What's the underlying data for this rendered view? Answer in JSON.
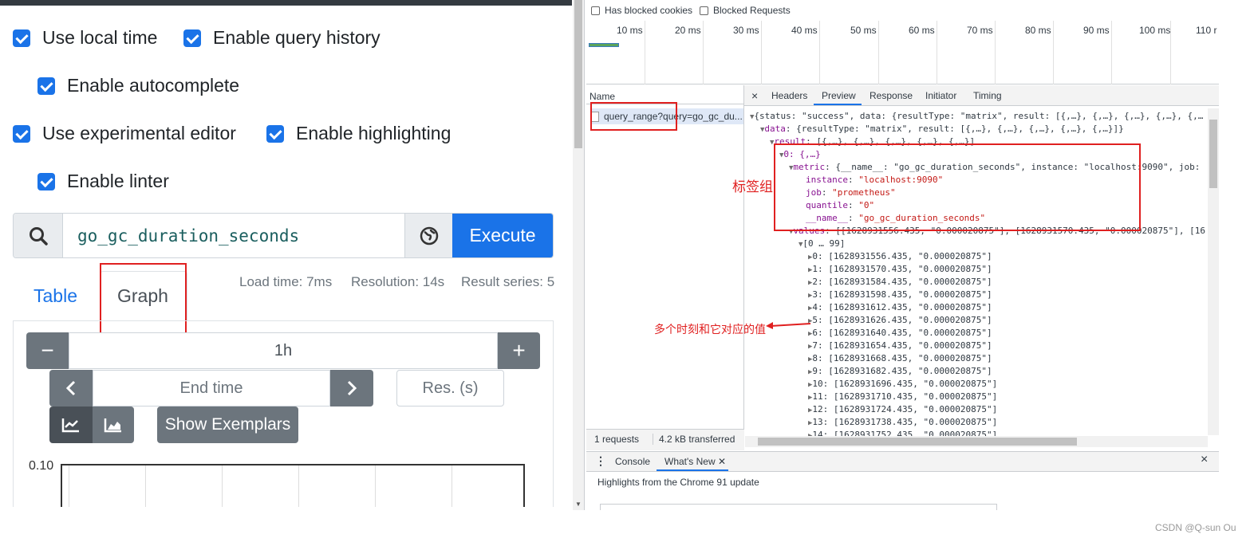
{
  "settings": {
    "use_local_time": "Use local time",
    "enable_query_history": "Enable query history",
    "enable_autocomplete": "Enable autocomplete",
    "use_experimental_editor": "Use experimental editor",
    "enable_highlighting": "Enable highlighting",
    "enable_linter": "Enable linter"
  },
  "query": {
    "value": "go_gc_duration_seconds",
    "execute_label": "Execute"
  },
  "tabs": {
    "table": "Table",
    "graph": "Graph"
  },
  "stats": {
    "load_time": "Load time: 7ms",
    "resolution": "Resolution: 14s",
    "result_series": "Result series: 5"
  },
  "graph_controls": {
    "minus": "−",
    "range": "1h",
    "plus": "+",
    "end_time_placeholder": "End time",
    "res_placeholder": "Res. (s)",
    "show_exemplars": "Show Exemplars",
    "y_tick_top": "0.10"
  },
  "devtools": {
    "has_blocked_cookies": "Has blocked cookies",
    "blocked_requests": "Blocked Requests",
    "timeline_ticks": [
      "10 ms",
      "20 ms",
      "30 ms",
      "40 ms",
      "50 ms",
      "60 ms",
      "70 ms",
      "80 ms",
      "90 ms",
      "100 ms",
      "110 r"
    ],
    "name_header": "Name",
    "request_name": "query_range?query=go_gc_du...",
    "detail_tabs": [
      "Headers",
      "Preview",
      "Response",
      "Initiator",
      "Timing"
    ],
    "close_x": "×",
    "footer_requests": "1 requests",
    "footer_transferred": "4.2 kB transferred",
    "drawer_tabs": [
      "Console",
      "What's New"
    ],
    "drawer_close": "×",
    "highlights": "Highlights from the Chrome 91 update",
    "preview_lines": {
      "l1": "{status: \"success\", data: {resultType: \"matrix\", result: [{,…}, {,…}, {,…}, {,…}, {,…",
      "l2_key": "data",
      "l2": ": {resultType: \"matrix\", result: [{,…}, {,…}, {,…}, {,…}, {,…}]}",
      "l3_key": "result",
      "l3": ": [{,…}, {,…}, {,…}, {,…}, {,…}]",
      "l4": "0: {,…}",
      "l5_key": "metric",
      "l5": ": {__name__: \"go_gc_duration_seconds\", instance: \"localhost:9090\", job:",
      "l6_key": "instance",
      "l6": "\"localhost:9090\"",
      "l7_key": "job",
      "l7": "\"prometheus\"",
      "l8_key": "quantile",
      "l8": "\"0\"",
      "l9_key": "__name__",
      "l9": "\"go_gc_duration_seconds\"",
      "l10_key": "values",
      "l10": ": [[1628931556.435, \"0.000020875\"], [1628931570.435, \"0.000020875\"], [16",
      "l11": "[0 … 99]",
      "values": [
        "0: [1628931556.435, \"0.000020875\"]",
        "1: [1628931570.435, \"0.000020875\"]",
        "2: [1628931584.435, \"0.000020875\"]",
        "3: [1628931598.435, \"0.000020875\"]",
        "4: [1628931612.435, \"0.000020875\"]",
        "5: [1628931626.435, \"0.000020875\"]",
        "6: [1628931640.435, \"0.000020875\"]",
        "7: [1628931654.435, \"0.000020875\"]",
        "8: [1628931668.435, \"0.000020875\"]",
        "9: [1628931682.435, \"0.000020875\"]",
        "10: [1628931696.435, \"0.000020875\"]",
        "11: [1628931710.435, \"0.000020875\"]",
        "12: [1628931724.435, \"0.000020875\"]",
        "13: [1628931738.435, \"0.000020875\"]",
        "14: [1628931752.435, \"0.000020875\"]"
      ]
    }
  },
  "annotations": {
    "label_group": "标签组",
    "times_and_values": "多个时刻和它对应的值"
  },
  "watermark": "CSDN @Q-sun Ou"
}
